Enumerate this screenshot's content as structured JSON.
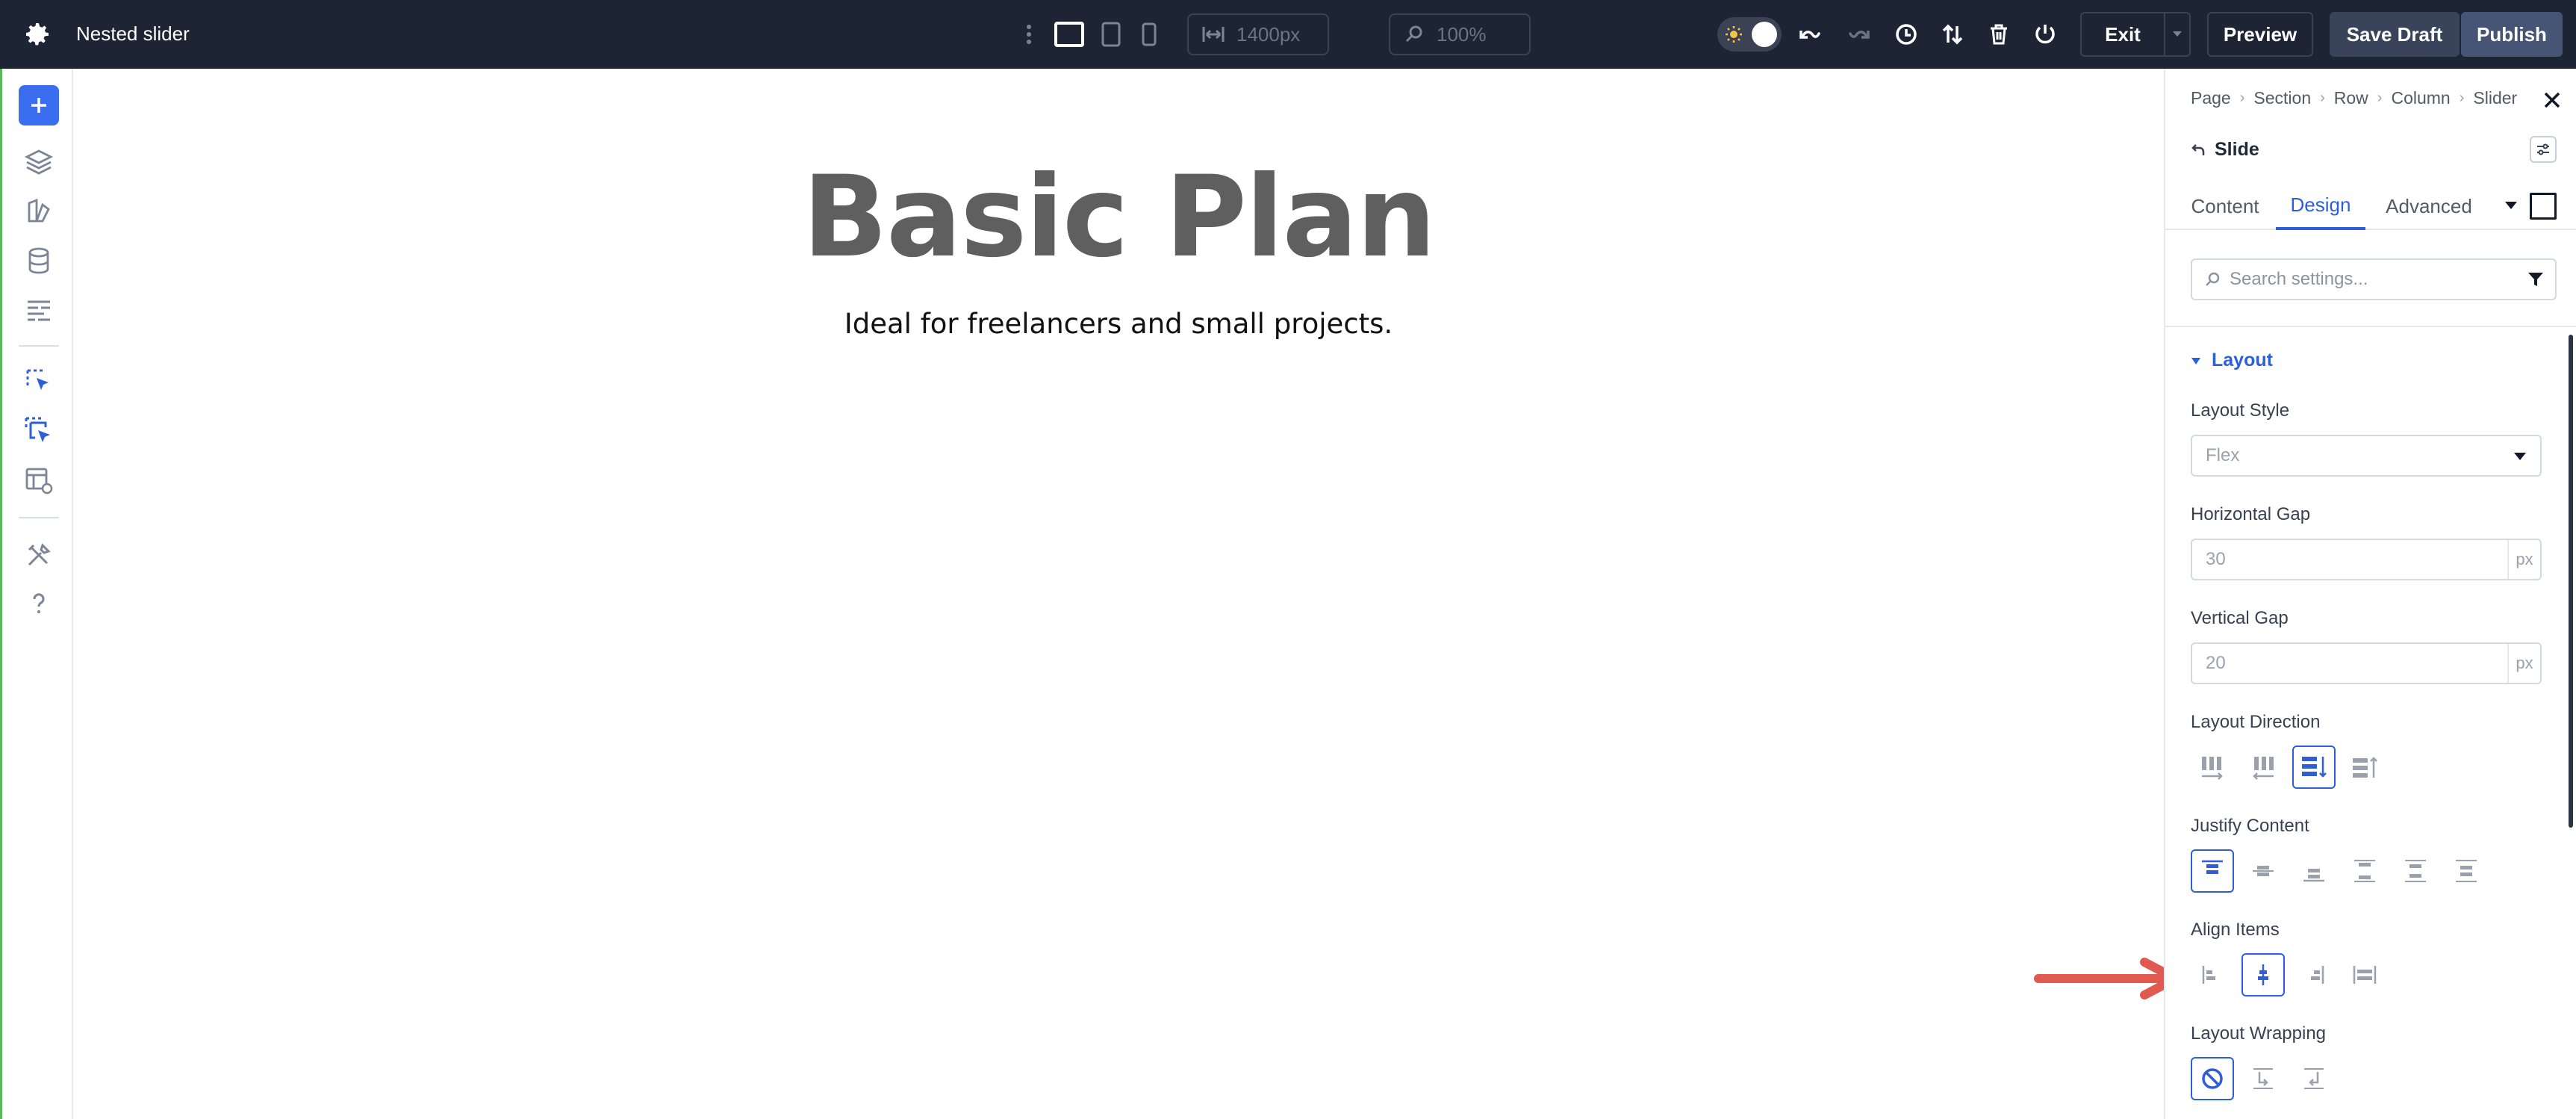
{
  "topbar": {
    "title": "Nested slider",
    "width_value": "1400px",
    "zoom_value": "100%",
    "exit_label": "Exit",
    "preview_label": "Preview",
    "save_draft_label": "Save Draft",
    "publish_label": "Publish"
  },
  "canvas": {
    "heading": "Basic Plan",
    "subheading": "Ideal for freelancers and small projects."
  },
  "panel": {
    "breadcrumbs": [
      "Page",
      "Section",
      "Row",
      "Column",
      "Slider"
    ],
    "element_name": "Slide",
    "tabs": [
      "Content",
      "Design",
      "Advanced"
    ],
    "active_tab": "Design",
    "search_placeholder": "Search settings...",
    "section_title": "Layout",
    "layout_style": {
      "label": "Layout Style",
      "value": "Flex"
    },
    "horizontal_gap": {
      "label": "Horizontal Gap",
      "value": "30",
      "unit": "px"
    },
    "vertical_gap": {
      "label": "Vertical Gap",
      "value": "20",
      "unit": "px"
    },
    "layout_direction": {
      "label": "Layout Direction",
      "selected": "column"
    },
    "justify_content": {
      "label": "Justify Content",
      "selected": "start"
    },
    "align_items": {
      "label": "Align Items",
      "selected": "center"
    },
    "layout_wrapping": {
      "label": "Layout Wrapping",
      "selected": "nowrap"
    }
  },
  "colors": {
    "accent": "#2e5fd8",
    "topbar": "#1d2433",
    "arrow": "#e05a4f"
  }
}
